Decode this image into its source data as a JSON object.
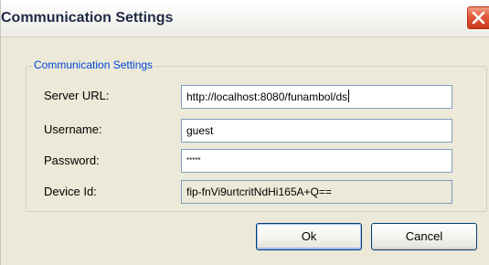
{
  "window": {
    "title": "Communication Settings",
    "close_icon": "close-x-icon",
    "colors": {
      "dialog_bg": "#ECE9D8",
      "legend_text": "#0046d5",
      "close_button": "#e05a3a",
      "input_border": "#7f9db9"
    }
  },
  "group": {
    "legend": "Communication Settings"
  },
  "fields": {
    "server_url": {
      "label": "Server URL:",
      "value": "http://localhost:8080/funambol/ds"
    },
    "username": {
      "label": "Username:",
      "value": "guest"
    },
    "password": {
      "label": "Password:",
      "value": "*****"
    },
    "device_id": {
      "label": "Device Id:",
      "value": "fip-fnVi9urtcritNdHi165A+Q=="
    }
  },
  "buttons": {
    "ok": "Ok",
    "cancel": "Cancel"
  }
}
